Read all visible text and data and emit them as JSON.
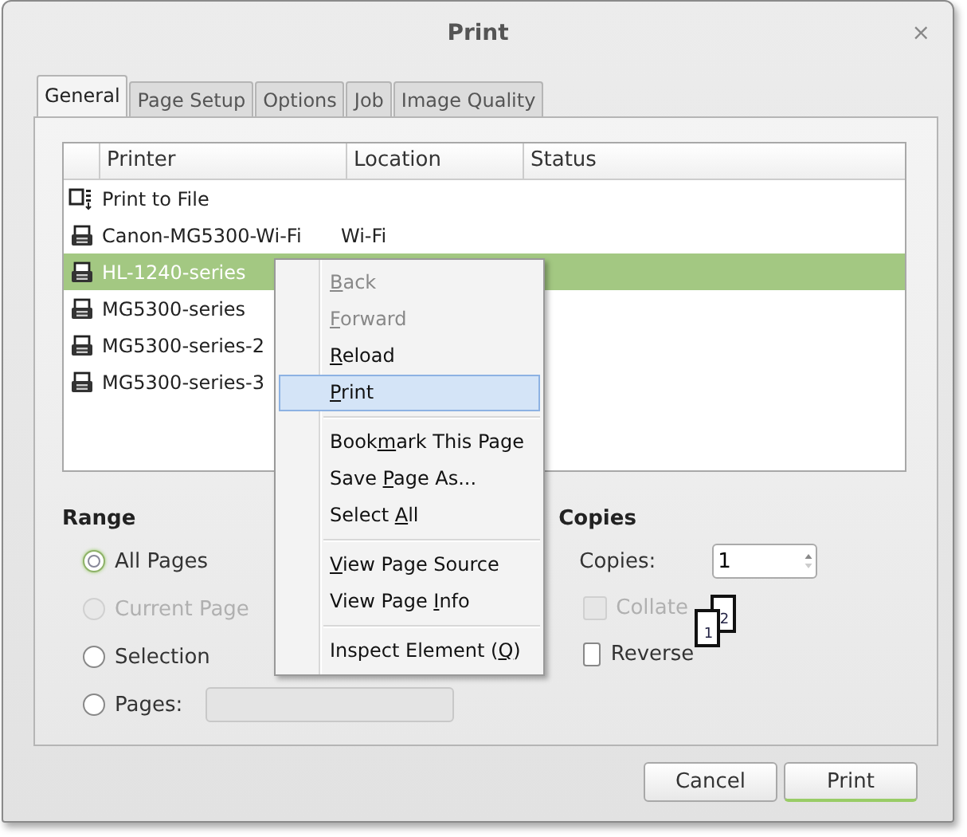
{
  "window": {
    "title": "Print",
    "close": "×"
  },
  "tabs": [
    {
      "label": "General",
      "selected": true
    },
    {
      "label": "Page Setup",
      "selected": false
    },
    {
      "label": "Options",
      "selected": false
    },
    {
      "label": "Job",
      "selected": false
    },
    {
      "label": "Image Quality",
      "selected": false
    }
  ],
  "printers": {
    "columns": [
      "Printer",
      "Location",
      "Status"
    ],
    "rows": [
      {
        "kind": "file",
        "name": "Print to File",
        "selected": false
      },
      {
        "kind": "printer",
        "name": "Canon-MG5300-Wi-Fi",
        "location": "Wi-Fi",
        "selected": false
      },
      {
        "kind": "printer",
        "name": "HL-1240-series",
        "selected": true
      },
      {
        "kind": "printer",
        "name": "MG5300-series",
        "selected": false
      },
      {
        "kind": "printer",
        "name": "MG5300-series-2",
        "selected": false
      },
      {
        "kind": "printer",
        "name": "MG5300-series-3",
        "selected": false
      }
    ]
  },
  "range": {
    "title": "Range",
    "options": [
      {
        "label": "All Pages",
        "selected": true,
        "disabled": false
      },
      {
        "label": "Current Page",
        "selected": false,
        "disabled": true
      },
      {
        "label": "Selection",
        "selected": false,
        "disabled": false
      },
      {
        "label": "Pages:",
        "selected": false,
        "disabled": false,
        "kind": "with_field"
      }
    ],
    "pages_field": {
      "disabled": true
    }
  },
  "copies": {
    "title": "Copies",
    "label": "Copies:",
    "value": "1",
    "collate": {
      "label": "Collate",
      "checked": false,
      "disabled": true
    },
    "reverse": {
      "label": "Reverse",
      "checked": false,
      "disabled": false
    },
    "sheets": [
      "2",
      "1"
    ]
  },
  "buttons": [
    {
      "label": "Cancel",
      "kind": "normal"
    },
    {
      "label": "Print",
      "kind": "default"
    }
  ],
  "context_menu": {
    "groups": [
      [
        {
          "parts": [
            {
              "text": "B",
              "underlined": true
            },
            {
              "text": "ack",
              "underlined": false
            }
          ],
          "disabled": true,
          "selected": false
        },
        {
          "parts": [
            {
              "text": "F",
              "underlined": true
            },
            {
              "text": "orward",
              "underlined": false
            }
          ],
          "disabled": true,
          "selected": false
        },
        {
          "parts": [
            {
              "text": "R",
              "underlined": true
            },
            {
              "text": "eload",
              "underlined": false
            }
          ],
          "disabled": false,
          "selected": false
        },
        {
          "parts": [
            {
              "text": "P",
              "underlined": true
            },
            {
              "text": "rint",
              "underlined": false
            }
          ],
          "disabled": false,
          "selected": true
        }
      ],
      [
        {
          "parts": [
            {
              "text": "Book",
              "underlined": false
            },
            {
              "text": "m",
              "underlined": true
            },
            {
              "text": "ark This Page",
              "underlined": false
            }
          ],
          "disabled": false,
          "selected": false
        },
        {
          "parts": [
            {
              "text": "Save ",
              "underlined": false
            },
            {
              "text": "P",
              "underlined": true
            },
            {
              "text": "age As...",
              "underlined": false
            }
          ],
          "disabled": false,
          "selected": false
        },
        {
          "parts": [
            {
              "text": "Select ",
              "underlined": false
            },
            {
              "text": "A",
              "underlined": true
            },
            {
              "text": "ll",
              "underlined": false
            }
          ],
          "disabled": false,
          "selected": false
        }
      ],
      [
        {
          "parts": [
            {
              "text": "V",
              "underlined": true
            },
            {
              "text": "iew Page Source",
              "underlined": false
            }
          ],
          "disabled": false,
          "selected": false
        },
        {
          "parts": [
            {
              "text": "View Page ",
              "underlined": false
            },
            {
              "text": "I",
              "underlined": true
            },
            {
              "text": "nfo",
              "underlined": false
            }
          ],
          "disabled": false,
          "selected": false
        }
      ],
      [
        {
          "parts": [
            {
              "text": "Inspect Element (",
              "underlined": false
            },
            {
              "text": "Q",
              "underlined": true
            },
            {
              "text": ")",
              "underlined": false
            }
          ],
          "disabled": false,
          "selected": false
        }
      ]
    ]
  }
}
